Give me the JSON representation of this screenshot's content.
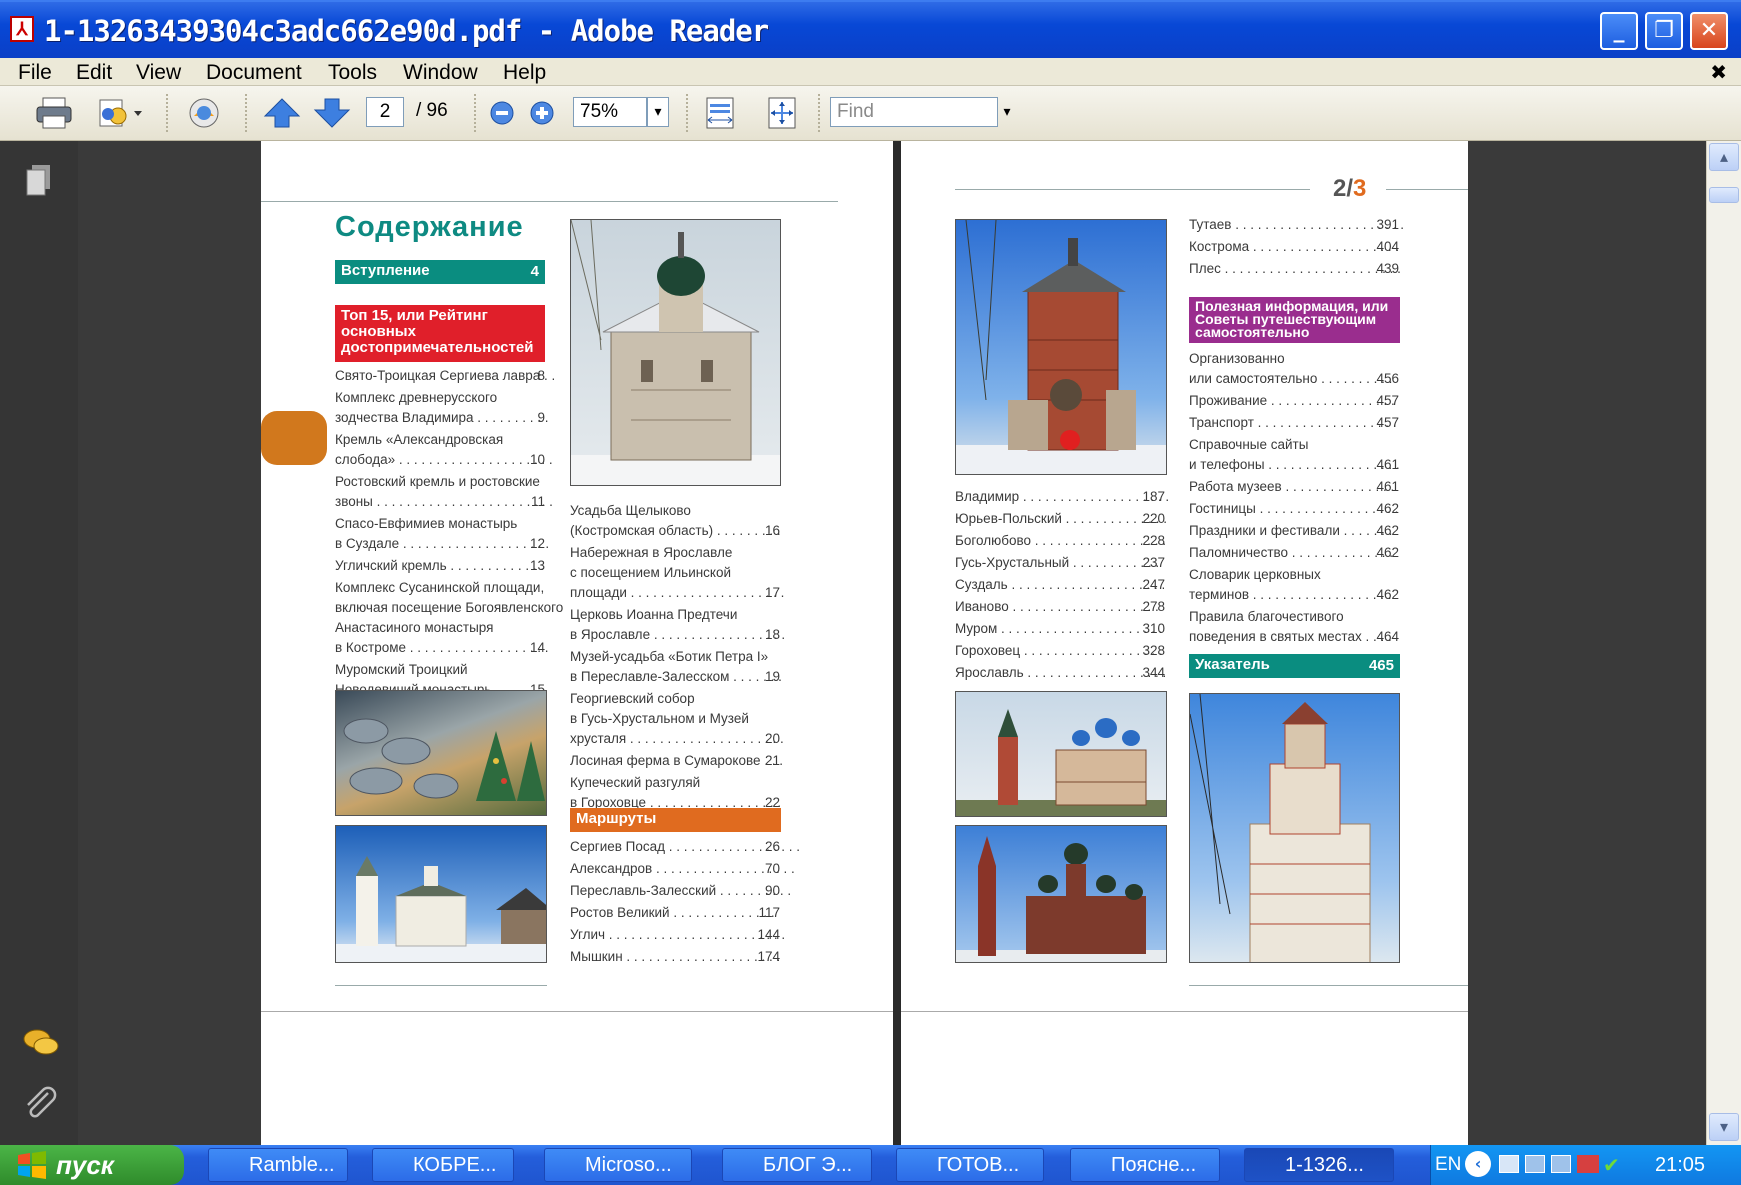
{
  "window": {
    "title": "1-13263439304c3adc662e90d.pdf - Adobe Reader"
  },
  "menu": [
    "File",
    "Edit",
    "View",
    "Document",
    "Tools",
    "Window",
    "Help"
  ],
  "toolbar": {
    "page_current": "2",
    "page_total": "/ 96",
    "zoom": "75%",
    "find_placeholder": "Find"
  },
  "left_page": {
    "title": "Содержание",
    "intro": {
      "label": "Вступление",
      "page": "4"
    },
    "top15": {
      "label": "Топ 15, или Рейтинг основных достопримечательностей"
    },
    "top15_items": [
      {
        "l1": "Свято-Троицкая Сергиева лавра . .",
        "p": "8"
      },
      {
        "l1": "Комплекс древнерусского",
        "l2": "зодчества Владимира . . . . . . . . . .",
        "p": "9"
      },
      {
        "l1": "Кремль «Александровская",
        "l2": "слобода» . . . . . . . . . . . . . . . . . . . . .",
        "p": "10"
      },
      {
        "l1": "Ростовский кремль и ростовские",
        "l2": "звоны . . . . . . . . . . . . . . . . . . . . . . . .",
        "p": "11"
      },
      {
        "l1": "Спасо-Евфимиев монастырь",
        "l2": "в Суздале . . . . . . . . . . . . . . . . . . . .",
        "p": "12"
      },
      {
        "l1": "Угличский кремль . . . . . . . . . . . . .",
        "p": "13"
      },
      {
        "l1": "Комплекс Сусанинской площади,",
        "l2": "включая посещение Богоявленского",
        "l3": "Анастасиного монастыря",
        "l4": "в Костроме . . . . . . . . . . . . . . . . . . .",
        "p": "14"
      },
      {
        "l1": "Муромский Троицкий",
        "l2": "Новодевичий монастырь . . . . . . .",
        "p": "15"
      }
    ],
    "col2_items": [
      {
        "l1": "Усадьба Щелыково",
        "l2": "(Костромская область) . . . . . . . . .",
        "p": "16"
      },
      {
        "l1": "Набережная в Ярославле",
        "l2": "с посещением Ильинской",
        "l3": "площади . . . . . . . . . . . . . . . . . . . . .",
        "p": "17"
      },
      {
        "l1": "Церковь Иоанна Предтечи",
        "l2": "в Ярославле . . . . . . . . . . . . . . . . . .",
        "p": "18"
      },
      {
        "l1": "Музей-усадьба «Ботик Петра I»",
        "l2": "в Переславле-Залесском . . . . . . .",
        "p": "19"
      },
      {
        "l1": "Георгиевский собор",
        "l2": "в Гусь-Хрустальном и Музей",
        "l3": "хрусталя . . . . . . . . . . . . . . . . . . . . .",
        "p": "20"
      },
      {
        "l1": "Лосиная ферма в Сумарокове . . .",
        "p": "21"
      },
      {
        "l1": "Купеческий разгуляй",
        "l2": "в Гороховце . . . . . . . . . . . . . . . . . .",
        "p": "22"
      }
    ],
    "routes": {
      "label": "Маршруты"
    },
    "routes_items": [
      {
        "l1": "Сергиев Посад . . . . . . . . . . . . . . . . . .",
        "p": "26"
      },
      {
        "l1": "Александров . . . . . . . . . . . . . . . . . . .",
        "p": "70"
      },
      {
        "l1": "Переславль-Залесский . . . . . . . . . .",
        "p": "90"
      },
      {
        "l1": "Ростов Великий . . . . . . . . . . . . . .",
        "p": "117"
      },
      {
        "l1": "Углич . . . . . . . . . . . . . . . . . . . . . . . .",
        "p": "144"
      },
      {
        "l1": "Мышкин . . . . . . . . . . . . . . . . . . . . .",
        "p": "174"
      }
    ]
  },
  "right_page": {
    "page_label_a": "2/",
    "page_label_b": "3",
    "cities": [
      {
        "l1": "Владимир . . . . . . . . . . . . . . . . . . . .",
        "p": "187"
      },
      {
        "l1": "Юрьев-Польский . . . . . . . . . . . . . .",
        "p": "220"
      },
      {
        "l1": "Боголюбово . . . . . . . . . . . . . . . . . .",
        "p": "228"
      },
      {
        "l1": "Гусь-Хрустальный . . . . . . . . . . . .",
        "p": "237"
      },
      {
        "l1": "Суздаль . . . . . . . . . . . . . . . . . . . . .",
        "p": "247"
      },
      {
        "l1": "Иваново . . . . . . . . . . . . . . . . . . . .",
        "p": "278"
      },
      {
        "l1": "Муром . . . . . . . . . . . . . . . . . . . . . .",
        "p": "310"
      },
      {
        "l1": "Гороховец . . . . . . . . . . . . . . . . . . .",
        "p": "328"
      },
      {
        "l1": "Ярославль . . . . . . . . . . . . . . . . . . .",
        "p": "344"
      }
    ],
    "cities2": [
      {
        "l1": "Тутаев . . . . . . . . . . . . . . . . . . . . . . .",
        "p": "391"
      },
      {
        "l1": "Кострома . . . . . . . . . . . . . . . . . . . .",
        "p": "404"
      },
      {
        "l1": "Плес . . . . . . . . . . . . . . . . . . . . . . . .",
        "p": "439"
      }
    ],
    "useful": {
      "label": "Полезная информация, или Советы путешествующим самостоятельно"
    },
    "useful_items": [
      {
        "l1": "Организованно",
        "l2": "или самостоятельно . . . . . . . . . .",
        "p": "456"
      },
      {
        "l1": "Проживание . . . . . . . . . . . . . . . . .",
        "p": "457"
      },
      {
        "l1": "Транспорт . . . . . . . . . . . . . . . . . . .",
        "p": "457"
      },
      {
        "l1": "Справочные сайты",
        "l2": "и телефоны . . . . . . . . . . . . . . . . . .",
        "p": "461"
      },
      {
        "l1": "Работа музеев . . . . . . . . . . . . . . .",
        "p": "461"
      },
      {
        "l1": "Гостиницы . . . . . . . . . . . . . . . . . . .",
        "p": "462"
      },
      {
        "l1": "Праздники и фестивали . . . . . . .",
        "p": "462"
      },
      {
        "l1": "Паломничество . . . . . . . . . . . . . .",
        "p": "462"
      },
      {
        "l1": "Словарик церковных",
        "l2": "терминов . . . . . . . . . . . . . . . . . . .",
        "p": "462"
      },
      {
        "l1": "Правила благочестивого",
        "l2": "поведения в святых местах . . . .",
        "p": "464"
      }
    ],
    "index": {
      "label": "Указатель",
      "page": "465"
    }
  },
  "taskbar": {
    "start": "пуск",
    "tasks": [
      "Ramble...",
      "КОБРЕ...",
      "Microso...",
      "БЛОГ Э...",
      "ГОТОВ...",
      "Поясне...",
      "1-1326..."
    ],
    "lang": "EN",
    "clock": "21:05"
  }
}
